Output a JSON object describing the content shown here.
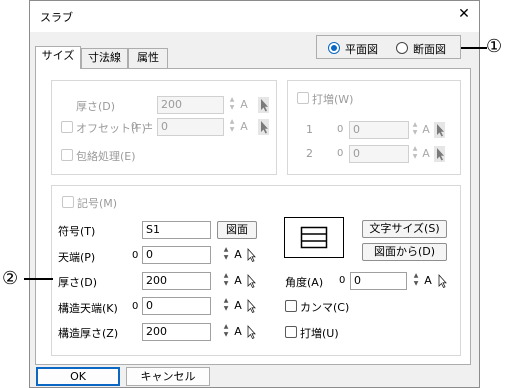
{
  "window": {
    "title": "スラブ",
    "close_glyph": "✕"
  },
  "view_mode": {
    "options": [
      "平面図",
      "断面図"
    ],
    "selected": "平面図"
  },
  "tabs": [
    "サイズ",
    "寸法線",
    "属性"
  ],
  "active_tab": "サイズ",
  "size_group": {
    "thickness_label": "厚さ(D)",
    "thickness_value": "200",
    "offset_label": "オフセット(F)",
    "offset_zero": "0",
    "offset_pm": "±",
    "offset_value": "0",
    "envelope_label": "包絡処理(E)"
  },
  "dazo_group": {
    "checkbox_label": "打増(W)",
    "row1_label": "1",
    "row1_zero": "0",
    "row1_value": "0",
    "row2_label": "2",
    "row2_zero": "0",
    "row2_value": "0"
  },
  "symbol_group": {
    "checkbox_label": "記号(M)",
    "code_label": "符号(T)",
    "code_value": "S1",
    "zumen_button": "図面",
    "top_label": "天端(P)",
    "top_zero": "0",
    "top_value": "0",
    "thickness_label": "厚さ(D)",
    "thickness_value": "200",
    "struct_top_label": "構造天端(K)",
    "struct_top_zero": "0",
    "struct_top_value": "0",
    "struct_thickness_label": "構造厚さ(Z)",
    "struct_thickness_value": "200",
    "text_size_button": "文字サイズ(S)",
    "from_drawing_button": "図面から(D)",
    "angle_label": "角度(A)",
    "angle_zero": "0",
    "angle_value": "0",
    "comma_label": "カンマ(C)",
    "dazo_label": "打増(U)"
  },
  "a_glyph": "A",
  "footer": {
    "ok": "OK",
    "cancel": "キャンセル"
  },
  "callouts": {
    "first": "①",
    "second": "②"
  },
  "colors": {
    "accent": "#0a67c4",
    "disabled_text": "#9b9b9b"
  }
}
